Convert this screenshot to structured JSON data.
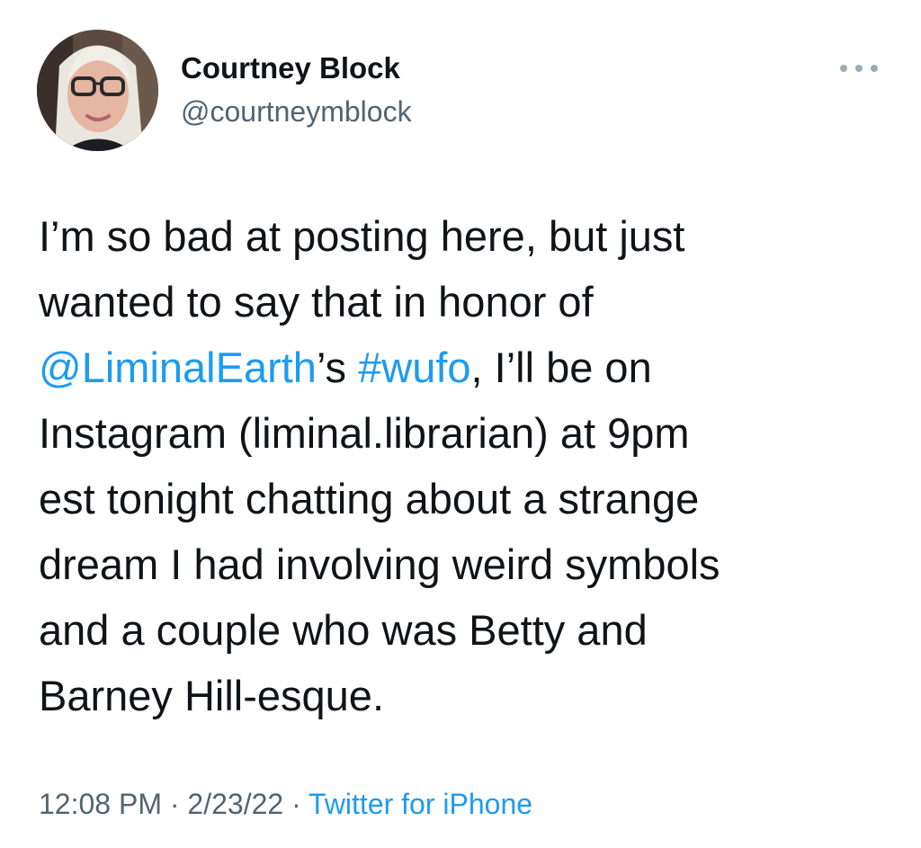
{
  "author": {
    "name": "Courtney Block",
    "handle": "@courtneymblock"
  },
  "tweet": {
    "line1": "I’m so bad at posting here, but just",
    "line2": "wanted to say that in honor of",
    "mention": "@LiminalEarth",
    "mention_suffix": "’s ",
    "hashtag": "#wufo",
    "line3_rest": ", I’ll be on",
    "line4": "Instagram (liminal.librarian) at 9pm",
    "line5": "est tonight chatting about a strange",
    "line6": "dream I had involving weird symbols",
    "line7": "and a couple who was Betty and",
    "line8": "Barney Hill-esque."
  },
  "meta": {
    "time": "12:08 PM",
    "sep1": " · ",
    "date": "2/23/22",
    "sep2": " · ",
    "source": "Twitter for iPhone"
  },
  "icons": {
    "more": "more-horizontal-icon"
  },
  "colors": {
    "link": "#1d9bf0",
    "secondary_text": "#536471",
    "primary_text": "#0f1419"
  }
}
